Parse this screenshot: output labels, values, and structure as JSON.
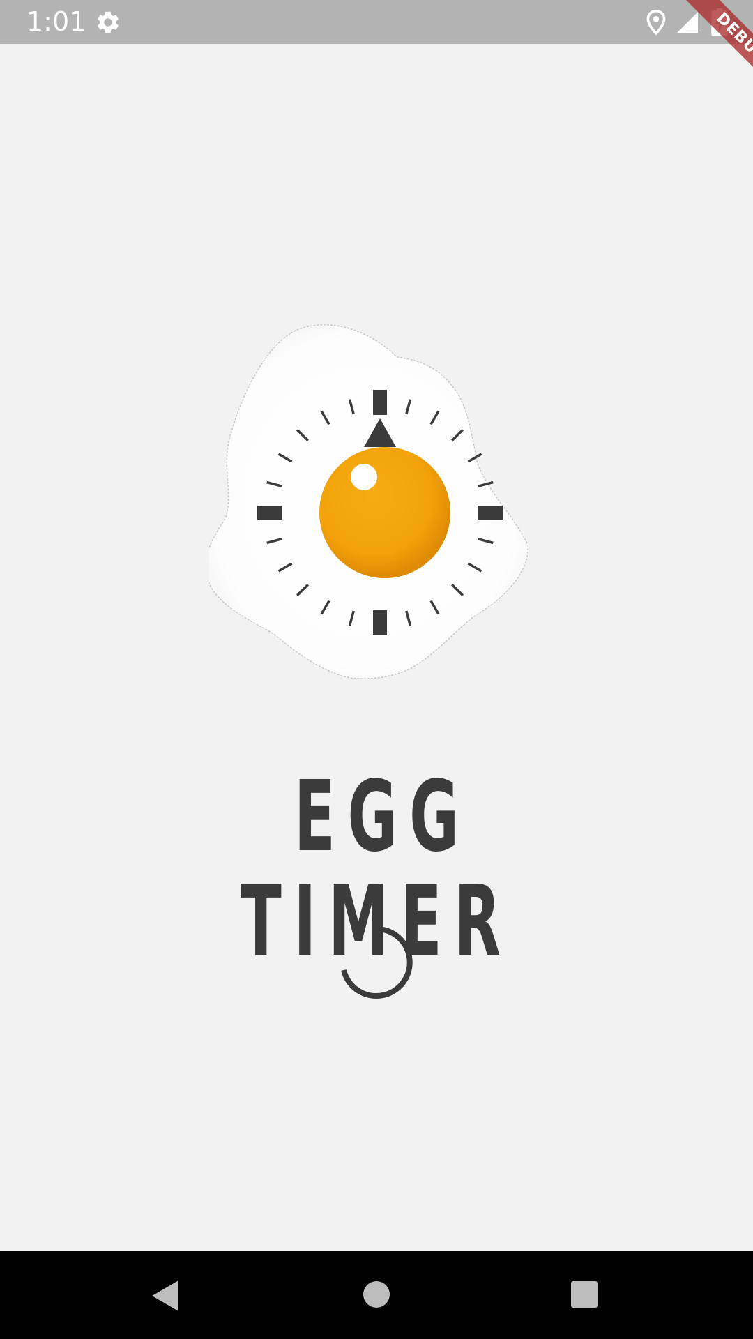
{
  "status_bar": {
    "time": "1:01",
    "icons": [
      "settings-gear-icon",
      "location-pin-icon",
      "cell-signal-icon",
      "battery-charging-icon"
    ],
    "background": "#b3b3b3"
  },
  "debug_banner": {
    "label": "DEBUG",
    "color": "#aa2c2c"
  },
  "splash": {
    "logo": "fried-egg-timer-logo",
    "title": "EGG TIMER",
    "loading_indicator": "circular-progress-spinner"
  },
  "navigation_bar": {
    "icons": [
      "back-triangle-icon",
      "home-circle-icon",
      "recents-square-icon"
    ]
  },
  "colors": {
    "background": "#f2f2f2",
    "egg_yolk": "#f4a20c",
    "title_text": "#3b3b3b",
    "spinner": "#3b3b3b",
    "nav_bar": "#000000"
  }
}
